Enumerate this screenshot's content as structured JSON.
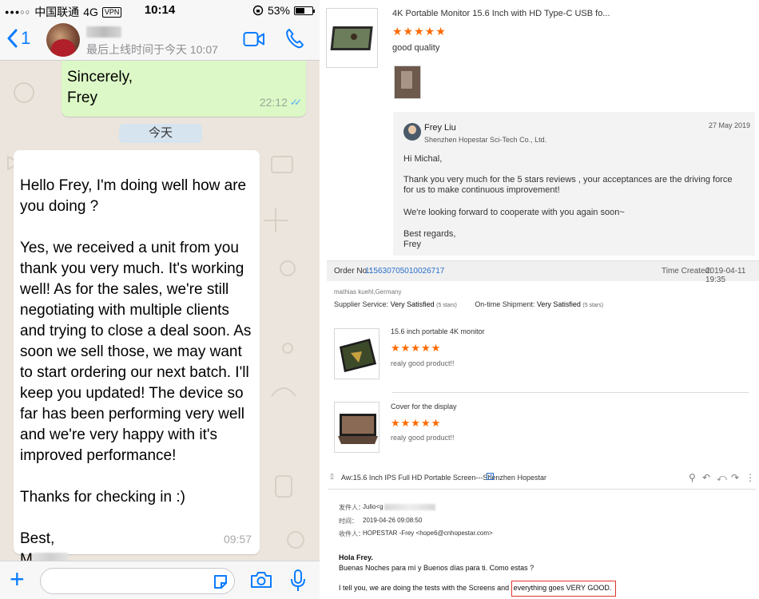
{
  "chat": {
    "status": {
      "carrier": "中国联通",
      "network": "4G",
      "vpn": "VPN",
      "time": "10:14",
      "battery": "53%",
      "battery_level": 0.53
    },
    "header": {
      "back_count": "1",
      "last_seen": "最后上线时间于今天 10:07",
      "video_icon": "video-camera-icon",
      "call_icon": "phone-icon"
    },
    "outgoing": {
      "text": "Sincerely,\nFrey",
      "time": "22:12",
      "status": "read"
    },
    "date_separator": "今天",
    "incoming": {
      "text": "Hello Frey, I'm doing well how are you doing ?\n\nYes, we received a unit from you thank you very much. It's working well! As for the sales, we're still negotiating with multiple clients and trying to close a deal soon. As soon we sell those, we may want to start ordering our next batch. I'll keep you updated! The device so far has been performing very well and we're very happy with it's improved performance!\n\nThanks for checking in :)\n\nBest,",
      "signature": "M",
      "time": "09:57"
    },
    "input": {
      "placeholder": ""
    }
  },
  "reviews": {
    "review1": {
      "product": "4K Portable Monitor 15.6 Inch with HD Type-C USB fo...",
      "stars": "★★★★★",
      "rating": 5,
      "comment": "good quality"
    },
    "reply": {
      "author": "Frey Liu",
      "company": "Shenzhen Hopestar Sci-Tech Co., Ltd.",
      "date": "27 May 2019",
      "greeting": "Hi Michal,",
      "body1": "Thank you very much for the 5 stars reviews , your acceptances are the driving force for us to make continuous improvement!",
      "body2": "We're looking forward to cooperate with you again soon~",
      "closing": "Best regards,",
      "name": "Frey"
    },
    "order": {
      "label": "Order No.:",
      "number": "115630705010026717",
      "time_label": "Time Created:",
      "time": "2019-04-11 19:35",
      "buyer": "mathias kuehl,Germany",
      "supplier_service_label": "Supplier Service:",
      "supplier_service": "Very Satisfied",
      "supplier_stars": "(5 stars)",
      "shipment_label": "On-time Shipment:",
      "shipment": "Very Satisfied",
      "shipment_stars": "(5 stars)",
      "items": [
        {
          "name": "15.6 inch portable 4K monitor",
          "stars": "★★★★★",
          "rating": 5,
          "comment": "realy good product!!"
        },
        {
          "name": "Cover for the display",
          "stars": "★★★★★",
          "rating": 5,
          "comment": "realy good product!!"
        }
      ]
    },
    "email": {
      "subject": "Aw:15.6 Inch IPS Full HD Portable Screen---Shenzhen Hopestar",
      "from_label": "发件人：",
      "from": "Julio<g",
      "time_label": "时间：",
      "time": "2019-04-26 09:08:50",
      "to_label": "收件人：",
      "to": "HOPESTAR -Frey <hope6@cnhopestar.com>",
      "greeting": "Hola Frey.",
      "line1": "Buenas Noches para mí y Buenos días para ti. Como estas ?",
      "line2_a": "I tell you, we are doing the tests with the Screens and ",
      "line2_b": "everything goes VERY GOOD."
    }
  }
}
